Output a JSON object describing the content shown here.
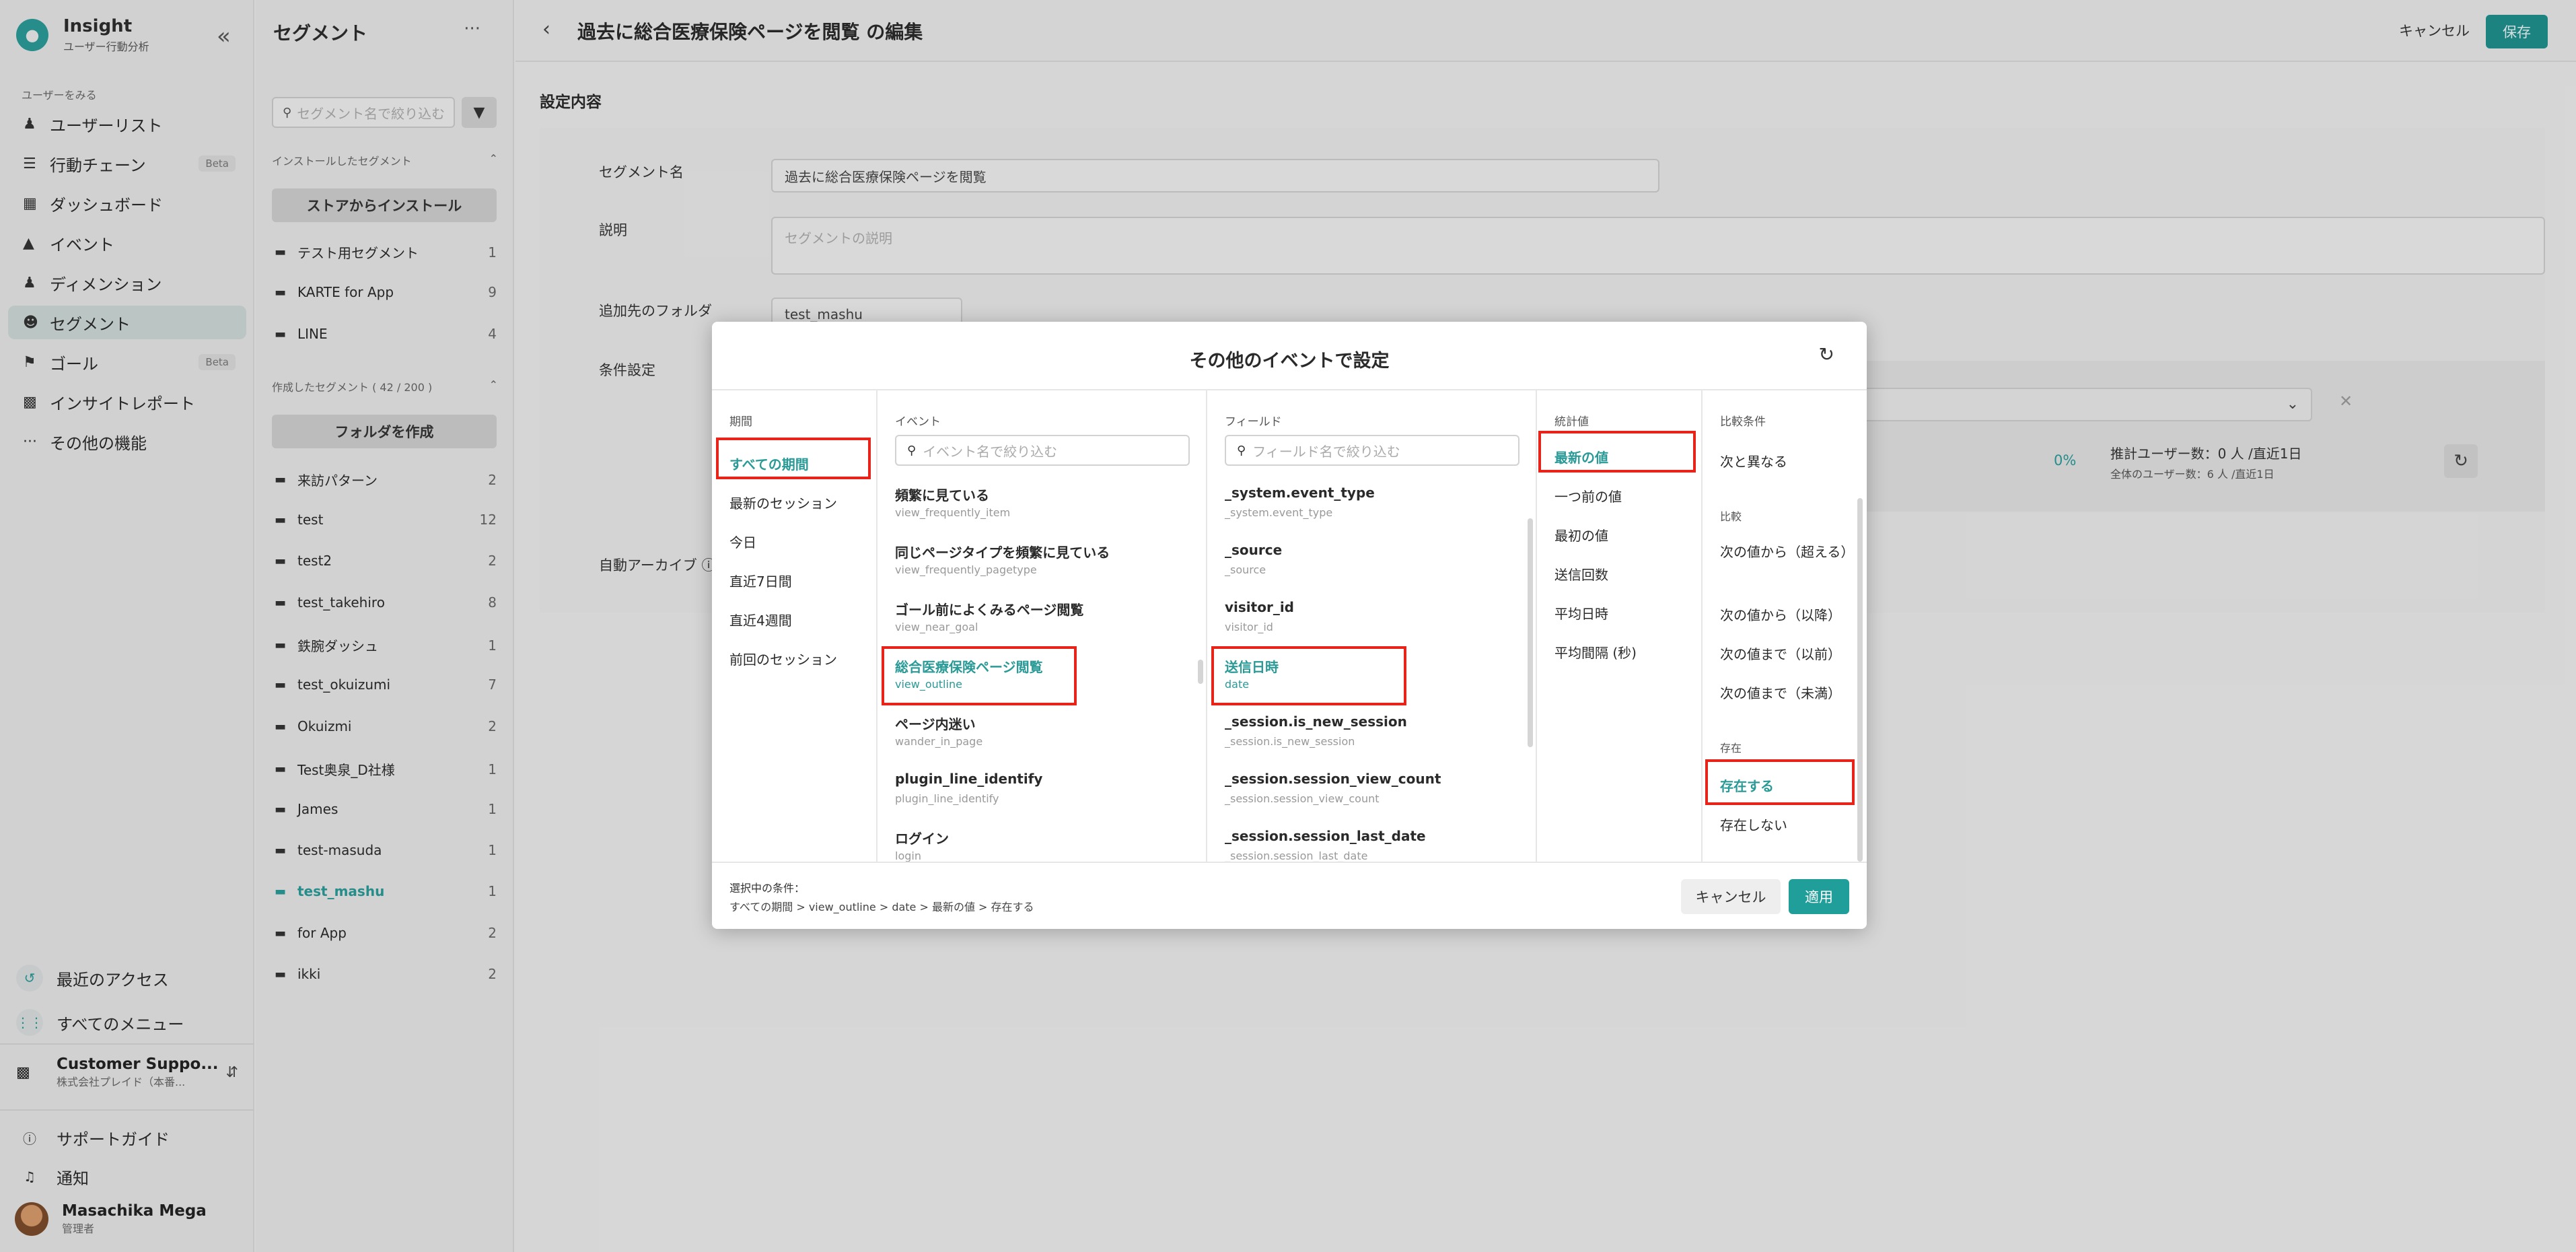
{
  "app": {
    "name": "Insight",
    "subtitle": "ユーザー行動分析"
  },
  "nav": {
    "section_label": "ユーザーをみる",
    "items": [
      {
        "label": "ユーザーリスト",
        "icon": "users-icon",
        "beta": ""
      },
      {
        "label": "行動チェーン",
        "icon": "chain-icon",
        "beta": "Beta"
      },
      {
        "label": "ダッシュボード",
        "icon": "dashboard-icon",
        "beta": ""
      },
      {
        "label": "イベント",
        "icon": "fire-icon",
        "beta": ""
      },
      {
        "label": "ディメンション",
        "icon": "dimension-icon",
        "beta": ""
      },
      {
        "label": "セグメント",
        "icon": "segment-icon",
        "beta": ""
      },
      {
        "label": "ゴール",
        "icon": "flag-icon",
        "beta": "Beta"
      },
      {
        "label": "インサイトレポート",
        "icon": "report-icon",
        "beta": ""
      },
      {
        "label": "その他の機能",
        "icon": "more-icon",
        "beta": ""
      }
    ],
    "recent": "最近のアクセス",
    "all_menu": "すべてのメニュー",
    "workspace": {
      "name": "Customer Suppo...",
      "sub": "株式会社プレイド（本番..."
    },
    "support": "サポートガイド",
    "notice": "通知",
    "user": {
      "name": "Masachika Mega",
      "role": "管理者"
    }
  },
  "segpanel": {
    "title": "セグメント",
    "search_placeholder": "セグメント名で絞り込む",
    "installed_label": "インストールしたセグメント",
    "install_button": "ストアからインストール",
    "installed": [
      {
        "name": "テスト用セグメント",
        "count": "1"
      },
      {
        "name": "KARTE for App",
        "count": "9"
      },
      {
        "name": "LINE",
        "count": "4"
      }
    ],
    "created_label": "作成したセグメント ( 42 / 200 )",
    "create_folder_button": "フォルダを作成",
    "created": [
      {
        "name": "来訪パターン",
        "count": "2"
      },
      {
        "name": "test",
        "count": "12"
      },
      {
        "name": "test2",
        "count": "2"
      },
      {
        "name": "test_takehiro",
        "count": "8"
      },
      {
        "name": "鉄腕ダッシュ",
        "count": "1"
      },
      {
        "name": "test_okuizumi",
        "count": "7"
      },
      {
        "name": "Okuizmi",
        "count": "2"
      },
      {
        "name": "Test奥泉_D社様",
        "count": "1"
      },
      {
        "name": "James",
        "count": "1"
      },
      {
        "name": "test-masuda",
        "count": "1"
      },
      {
        "name": "test_mashu",
        "count": "1"
      },
      {
        "name": "for App",
        "count": "2"
      },
      {
        "name": "ikki",
        "count": "2"
      }
    ]
  },
  "main": {
    "title": "過去に総合医療保険ページを閲覧 の編集",
    "cancel": "キャンセル",
    "save": "保存",
    "settings_heading": "設定内容",
    "labels": {
      "name": "セグメント名",
      "description": "説明",
      "folder": "追加先のフォルダ",
      "condition": "条件設定",
      "auto_archive": "自動アーカイブ"
    },
    "name_value": "過去に総合医療保険ページを閲覧",
    "description_placeholder": "セグメントの説明",
    "folder_value": "test_mashu",
    "percent": "0%",
    "estimate": "推計ユーザー数：0 人 /直近1日",
    "estimate_sub": "全体のユーザー数：6 人 /直近1日"
  },
  "modal": {
    "title": "その他のイベントで設定",
    "columns": {
      "period": "期間",
      "event": "イベント",
      "field": "フィールド",
      "stat": "統計値",
      "compare": "比較条件"
    },
    "periods": [
      "すべての期間",
      "最新のセッション",
      "今日",
      "直近7日間",
      "直近4週間",
      "前回のセッション"
    ],
    "event_search_placeholder": "イベント名で絞り込む",
    "events": [
      {
        "title": "頻繁に見ている",
        "sub": "view_frequently_item"
      },
      {
        "title": "同じページタイプを頻繁に見ている",
        "sub": "view_frequently_pagetype"
      },
      {
        "title": "ゴール前によくみるページ閲覧",
        "sub": "view_near_goal"
      },
      {
        "title": "総合医療保険ページ閲覧",
        "sub": "view_outline"
      },
      {
        "title": "ページ内迷い",
        "sub": "wander_in_page"
      },
      {
        "title": "plugin_line_identify",
        "sub": "plugin_line_identify"
      },
      {
        "title": "ログイン",
        "sub": "login"
      }
    ],
    "field_search_placeholder": "フィールド名で絞り込む",
    "fields": [
      {
        "title": "_system.event_type",
        "sub": "_system.event_type"
      },
      {
        "title": "_source",
        "sub": "_source"
      },
      {
        "title": "visitor_id",
        "sub": "visitor_id"
      },
      {
        "title": "送信日時",
        "sub": "date"
      },
      {
        "title": "_session.is_new_session",
        "sub": "_session.is_new_session"
      },
      {
        "title": "_session.session_view_count",
        "sub": "_session.session_view_count"
      },
      {
        "title": "_session.session_last_date",
        "sub": "_session.session_last_date"
      }
    ],
    "stats": [
      "最新の値",
      "一つ前の値",
      "最初の値",
      "送信回数",
      "平均日時",
      "平均間隔 (秒)"
    ],
    "compare": {
      "top": "次と異なる",
      "group_compare": "比較",
      "compare_items": [
        "次の値から（超える）",
        "次の値から（以降）",
        "次の値まで（以前）",
        "次の値まで（未満）"
      ],
      "group_exist": "存在",
      "exist_items": [
        "存在する",
        "存在しない"
      ]
    },
    "footer_label": "選択中の条件：",
    "footer_path": "すべての期間 > view_outline > date > 最新の値 > 存在する",
    "cancel": "キャンセル",
    "apply": "適用"
  },
  "colors": {
    "accent": "#1f9e9a",
    "highlight_box": "#e8231a"
  }
}
